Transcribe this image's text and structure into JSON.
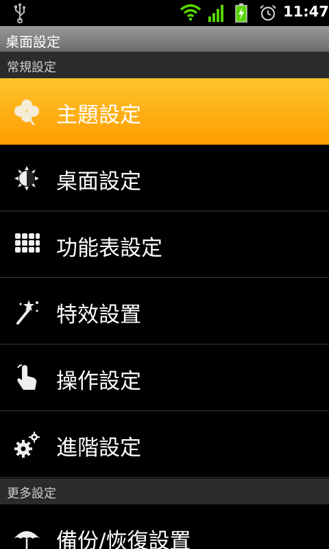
{
  "status_bar": {
    "time": "11:47",
    "icons": [
      "usb-icon",
      "wifi-icon",
      "signal-icon",
      "battery-charging-icon",
      "alarm-icon"
    ]
  },
  "title_bar": {
    "title": "桌面設定"
  },
  "sections": [
    {
      "label": "常規設定"
    },
    {
      "label": "更多設定"
    }
  ],
  "items": [
    {
      "label": "主題設定",
      "icon": "clover-icon",
      "selected": true
    },
    {
      "label": "桌面設定",
      "icon": "desktop-sun-icon"
    },
    {
      "label": "功能表設定",
      "icon": "grid-menu-icon"
    },
    {
      "label": "特效設置",
      "icon": "magic-wand-icon"
    },
    {
      "label": "操作設定",
      "icon": "touch-hand-icon"
    },
    {
      "label": "進階設定",
      "icon": "gears-icon"
    },
    {
      "label": "備份/恢復設置",
      "icon": "umbrella-icon"
    }
  ],
  "colors": {
    "accent": "#ffb000",
    "background": "#000000",
    "section": "#2b2b2b"
  }
}
